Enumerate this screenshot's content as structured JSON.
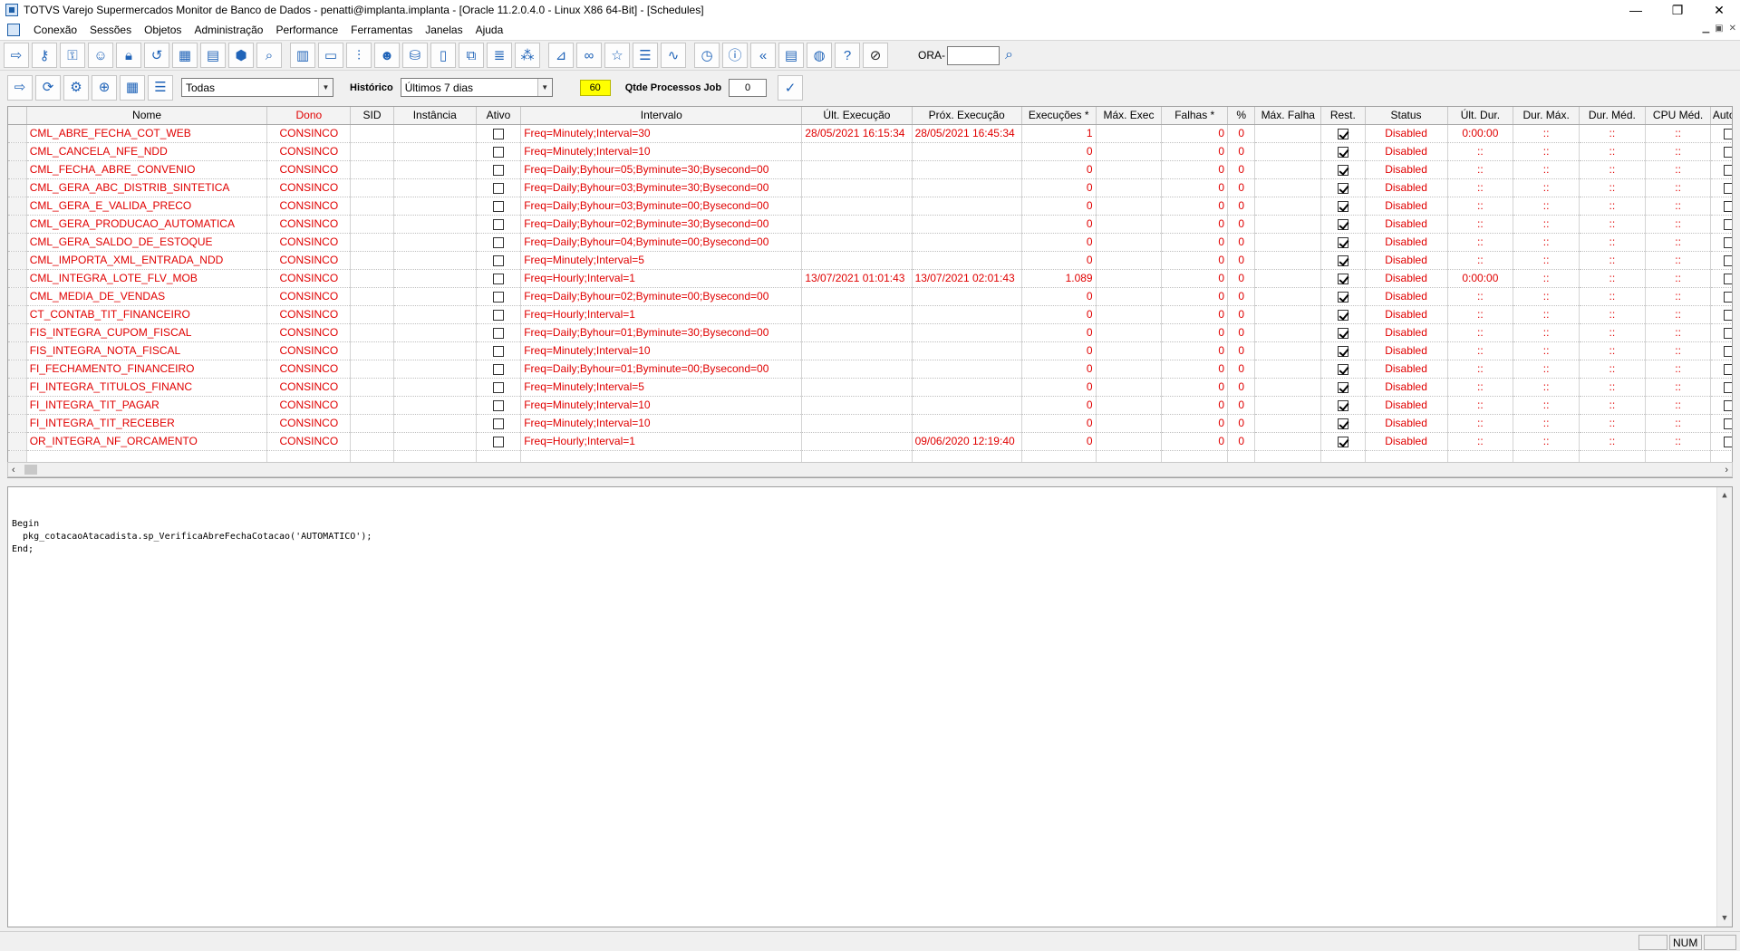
{
  "window": {
    "title": "TOTVS Varejo Supermercados Monitor de Banco de Dados - penatti@implanta.implanta - [Oracle 11.2.0.4.0 - Linux X86 64-Bit] - [Schedules]",
    "minimize": "—",
    "restore": "❐",
    "close": "✕"
  },
  "menu": [
    "Conexão",
    "Sessões",
    "Objetos",
    "Administração",
    "Performance",
    "Ferramentas",
    "Janelas",
    "Ajuda"
  ],
  "toolbar": {
    "icons": [
      "exit-icon",
      "key-icon",
      "key-search-icon",
      "user-icon",
      "lock-icon",
      "history-icon",
      "calendar-icon",
      "calendar-gear-icon",
      "package-icon",
      "search-icon",
      "report-icon",
      "storage-icon",
      "sliders-icon",
      "users-icon",
      "database-icon",
      "document-icon",
      "documents-icon",
      "file-text-icon",
      "footprints-icon",
      "chart-icon",
      "link-icon",
      "star-icon",
      "list-icon",
      "pulse-icon",
      "clock-icon",
      "info-icon",
      "rewind-icon",
      "calculator-icon",
      "globe-icon",
      "help-icon",
      "block-icon"
    ],
    "ora_label": "ORA-",
    "ora_value": ""
  },
  "toolbar2": {
    "owner_filter": "Todas",
    "history_label": "Histórico",
    "history_value": "Últimos 7 dias",
    "refresh_seconds": "60",
    "jobs_label": "Qtde Processos Job",
    "jobs_value": "0"
  },
  "grid": {
    "columns": [
      "Nome",
      "Dono",
      "SID",
      "Instância",
      "Ativo",
      "Intervalo",
      "Últ. Execução",
      "Próx. Execução",
      "Execuções *",
      "Máx. Exec",
      "Falhas *",
      "%",
      "Máx. Falha",
      "Rest.",
      "Status",
      "Últ. Dur.",
      "Dur. Máx.",
      "Dur. Méd.",
      "CPU Méd.",
      "Auto D"
    ],
    "rows": [
      {
        "nome": "CML_ABRE_FECHA_COT_WEB",
        "dono": "CONSINCO",
        "intervalo": "Freq=Minutely;Interval=30",
        "ult": "28/05/2021 16:15:34",
        "prox": "28/05/2021 16:45:34",
        "exec": "1",
        "falhas": "0",
        "pct": "0",
        "status": "Disabled",
        "ultdur": "0:00:00",
        "durmax": "::",
        "durmed": "::",
        "cpu": "::"
      },
      {
        "nome": "CML_CANCELA_NFE_NDD",
        "dono": "CONSINCO",
        "intervalo": "Freq=Minutely;Interval=10",
        "ult": "",
        "prox": "",
        "exec": "0",
        "falhas": "0",
        "pct": "0",
        "status": "Disabled",
        "ultdur": "::",
        "durmax": "::",
        "durmed": "::",
        "cpu": "::"
      },
      {
        "nome": "CML_FECHA_ABRE_CONVENIO",
        "dono": "CONSINCO",
        "intervalo": "Freq=Daily;Byhour=05;Byminute=30;Bysecond=00",
        "ult": "",
        "prox": "",
        "exec": "0",
        "falhas": "0",
        "pct": "0",
        "status": "Disabled",
        "ultdur": "::",
        "durmax": "::",
        "durmed": "::",
        "cpu": "::"
      },
      {
        "nome": "CML_GERA_ABC_DISTRIB_SINTETICA",
        "dono": "CONSINCO",
        "intervalo": "Freq=Daily;Byhour=03;Byminute=30;Bysecond=00",
        "ult": "",
        "prox": "",
        "exec": "0",
        "falhas": "0",
        "pct": "0",
        "status": "Disabled",
        "ultdur": "::",
        "durmax": "::",
        "durmed": "::",
        "cpu": "::"
      },
      {
        "nome": "CML_GERA_E_VALIDA_PRECO",
        "dono": "CONSINCO",
        "intervalo": "Freq=Daily;Byhour=03;Byminute=00;Bysecond=00",
        "ult": "",
        "prox": "",
        "exec": "0",
        "falhas": "0",
        "pct": "0",
        "status": "Disabled",
        "ultdur": "::",
        "durmax": "::",
        "durmed": "::",
        "cpu": "::"
      },
      {
        "nome": "CML_GERA_PRODUCAO_AUTOMATICA",
        "dono": "CONSINCO",
        "intervalo": "Freq=Daily;Byhour=02;Byminute=30;Bysecond=00",
        "ult": "",
        "prox": "",
        "exec": "0",
        "falhas": "0",
        "pct": "0",
        "status": "Disabled",
        "ultdur": "::",
        "durmax": "::",
        "durmed": "::",
        "cpu": "::"
      },
      {
        "nome": "CML_GERA_SALDO_DE_ESTOQUE",
        "dono": "CONSINCO",
        "intervalo": "Freq=Daily;Byhour=04;Byminute=00;Bysecond=00",
        "ult": "",
        "prox": "",
        "exec": "0",
        "falhas": "0",
        "pct": "0",
        "status": "Disabled",
        "ultdur": "::",
        "durmax": "::",
        "durmed": "::",
        "cpu": "::"
      },
      {
        "nome": "CML_IMPORTA_XML_ENTRADA_NDD",
        "dono": "CONSINCO",
        "intervalo": "Freq=Minutely;Interval=5",
        "ult": "",
        "prox": "",
        "exec": "0",
        "falhas": "0",
        "pct": "0",
        "status": "Disabled",
        "ultdur": "::",
        "durmax": "::",
        "durmed": "::",
        "cpu": "::"
      },
      {
        "nome": "CML_INTEGRA_LOTE_FLV_MOB",
        "dono": "CONSINCO",
        "intervalo": "Freq=Hourly;Interval=1",
        "ult": "13/07/2021 01:01:43",
        "prox": "13/07/2021 02:01:43",
        "exec": "1.089",
        "falhas": "0",
        "pct": "0",
        "status": "Disabled",
        "ultdur": "0:00:00",
        "durmax": "::",
        "durmed": "::",
        "cpu": "::"
      },
      {
        "nome": "CML_MEDIA_DE_VENDAS",
        "dono": "CONSINCO",
        "intervalo": "Freq=Daily;Byhour=02;Byminute=00;Bysecond=00",
        "ult": "",
        "prox": "",
        "exec": "0",
        "falhas": "0",
        "pct": "0",
        "status": "Disabled",
        "ultdur": "::",
        "durmax": "::",
        "durmed": "::",
        "cpu": "::"
      },
      {
        "nome": "CT_CONTAB_TIT_FINANCEIRO",
        "dono": "CONSINCO",
        "intervalo": "Freq=Hourly;Interval=1",
        "ult": "",
        "prox": "",
        "exec": "0",
        "falhas": "0",
        "pct": "0",
        "status": "Disabled",
        "ultdur": "::",
        "durmax": "::",
        "durmed": "::",
        "cpu": "::"
      },
      {
        "nome": "FIS_INTEGRA_CUPOM_FISCAL",
        "dono": "CONSINCO",
        "intervalo": "Freq=Daily;Byhour=01;Byminute=30;Bysecond=00",
        "ult": "",
        "prox": "",
        "exec": "0",
        "falhas": "0",
        "pct": "0",
        "status": "Disabled",
        "ultdur": "::",
        "durmax": "::",
        "durmed": "::",
        "cpu": "::"
      },
      {
        "nome": "FIS_INTEGRA_NOTA_FISCAL",
        "dono": "CONSINCO",
        "intervalo": "Freq=Minutely;Interval=10",
        "ult": "",
        "prox": "",
        "exec": "0",
        "falhas": "0",
        "pct": "0",
        "status": "Disabled",
        "ultdur": "::",
        "durmax": "::",
        "durmed": "::",
        "cpu": "::"
      },
      {
        "nome": "FI_FECHAMENTO_FINANCEIRO",
        "dono": "CONSINCO",
        "intervalo": "Freq=Daily;Byhour=01;Byminute=00;Bysecond=00",
        "ult": "",
        "prox": "",
        "exec": "0",
        "falhas": "0",
        "pct": "0",
        "status": "Disabled",
        "ultdur": "::",
        "durmax": "::",
        "durmed": "::",
        "cpu": "::"
      },
      {
        "nome": "FI_INTEGRA_TITULOS_FINANC",
        "dono": "CONSINCO",
        "intervalo": "Freq=Minutely;Interval=5",
        "ult": "",
        "prox": "",
        "exec": "0",
        "falhas": "0",
        "pct": "0",
        "status": "Disabled",
        "ultdur": "::",
        "durmax": "::",
        "durmed": "::",
        "cpu": "::"
      },
      {
        "nome": "FI_INTEGRA_TIT_PAGAR",
        "dono": "CONSINCO",
        "intervalo": "Freq=Minutely;Interval=10",
        "ult": "",
        "prox": "",
        "exec": "0",
        "falhas": "0",
        "pct": "0",
        "status": "Disabled",
        "ultdur": "::",
        "durmax": "::",
        "durmed": "::",
        "cpu": "::"
      },
      {
        "nome": "FI_INTEGRA_TIT_RECEBER",
        "dono": "CONSINCO",
        "intervalo": "Freq=Minutely;Interval=10",
        "ult": "",
        "prox": "",
        "exec": "0",
        "falhas": "0",
        "pct": "0",
        "status": "Disabled",
        "ultdur": "::",
        "durmax": "::",
        "durmed": "::",
        "cpu": "::"
      },
      {
        "nome": "OR_INTEGRA_NF_ORCAMENTO",
        "dono": "CONSINCO",
        "intervalo": "Freq=Hourly;Interval=1",
        "ult": "",
        "prox": "09/06/2020 12:19:40",
        "exec": "0",
        "falhas": "0",
        "pct": "0",
        "status": "Disabled",
        "ultdur": "::",
        "durmax": "::",
        "durmed": "::",
        "cpu": "::"
      }
    ]
  },
  "editor": {
    "code": "Begin\n  pkg_cotacaoAtacadista.sp_VerificaAbreFechaCotacao('AUTOMATICO');\nEnd;"
  },
  "statusbar": {
    "num": "NUM"
  },
  "colors": {
    "row_text": "#e00000",
    "icon": "#1f63b8",
    "refresh_badge": "#ffff00"
  }
}
